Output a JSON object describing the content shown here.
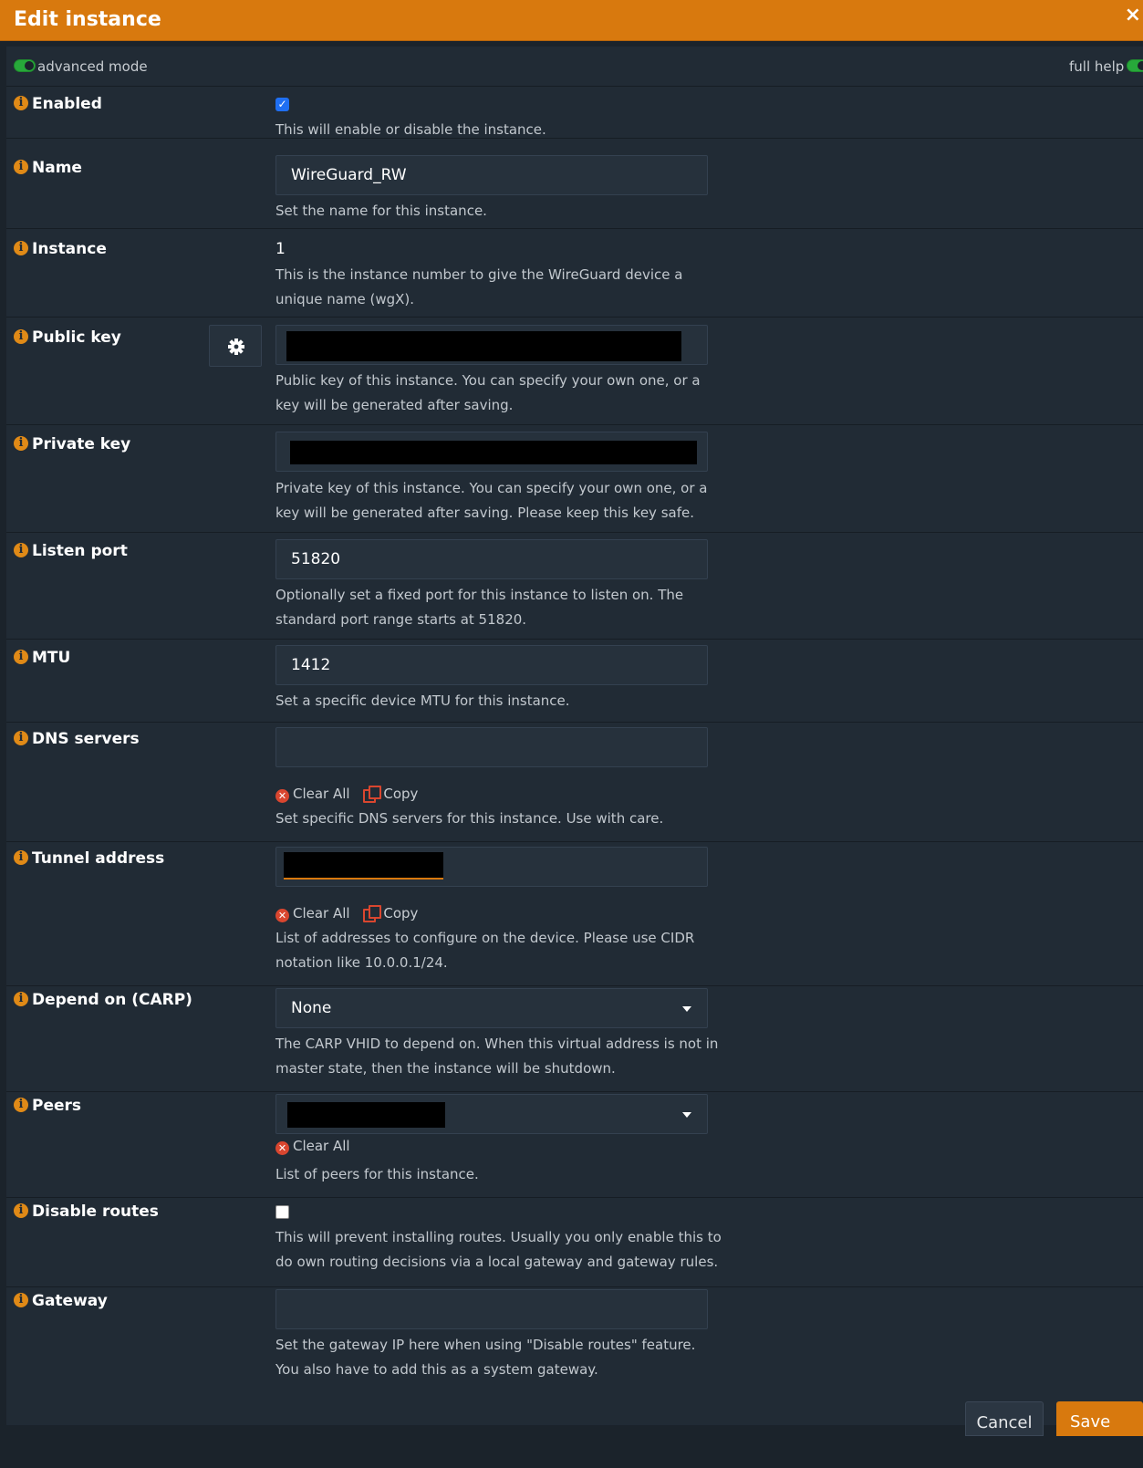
{
  "dialog": {
    "title": "Edit instance",
    "close_glyph": "×"
  },
  "modebar": {
    "advanced_label": "advanced mode",
    "help_label": "full help"
  },
  "fields": {
    "enabled": {
      "label": "Enabled",
      "checked": true,
      "help": "This will enable or disable the instance."
    },
    "name": {
      "label": "Name",
      "value": "WireGuard_RW",
      "help": "Set the name for this instance."
    },
    "instance": {
      "label": "Instance",
      "value": "1",
      "help": "This is the instance number to give the WireGuard device a unique name (wgX)."
    },
    "public_key": {
      "label": "Public key",
      "help": "Public key of this instance. You can specify your own one, or a key will be generated after saving."
    },
    "private_key": {
      "label": "Private key",
      "help": "Private key of this instance. You can specify your own one, or a key will be generated after saving. Please keep this key safe."
    },
    "listen_port": {
      "label": "Listen port",
      "value": "51820",
      "help": "Optionally set a fixed port for this instance to listen on. The standard port range starts at 51820."
    },
    "mtu": {
      "label": "MTU",
      "value": "1412",
      "help": "Set a specific device MTU for this instance."
    },
    "dns_servers": {
      "label": "DNS servers",
      "clear_label": "Clear All",
      "copy_label": "Copy",
      "help": "Set specific DNS servers for this instance. Use with care."
    },
    "tunnel_address": {
      "label": "Tunnel address",
      "clear_label": "Clear All",
      "copy_label": "Copy",
      "help": "List of addresses to configure on the device. Please use CIDR notation like 10.0.0.1/24."
    },
    "depend_carp": {
      "label": "Depend on (CARP)",
      "value": "None",
      "help": "The CARP VHID to depend on. When this virtual address is not in master state, then the instance will be shutdown."
    },
    "peers": {
      "label": "Peers",
      "clear_label": "Clear All",
      "help": "List of peers for this instance."
    },
    "disable_routes": {
      "label": "Disable routes",
      "checked": false,
      "help": "This will prevent installing routes. Usually you only enable this to do own routing decisions via a local gateway and gateway rules."
    },
    "gateway": {
      "label": "Gateway",
      "value": "",
      "help": "Set the gateway IP here when using \"Disable routes\" feature. You also have to add this as a system gateway."
    }
  },
  "footer": {
    "cancel_label": "Cancel",
    "save_label": "Save"
  },
  "colors": {
    "accent": "#d8790e",
    "toggle_on": "#27a93a",
    "danger": "#d9462f",
    "checkbox": "#1f6ff2"
  },
  "icons": [
    "info-icon",
    "gear-icon",
    "clear-all-icon",
    "copy-icon",
    "chevron-down-icon",
    "close-icon"
  ]
}
